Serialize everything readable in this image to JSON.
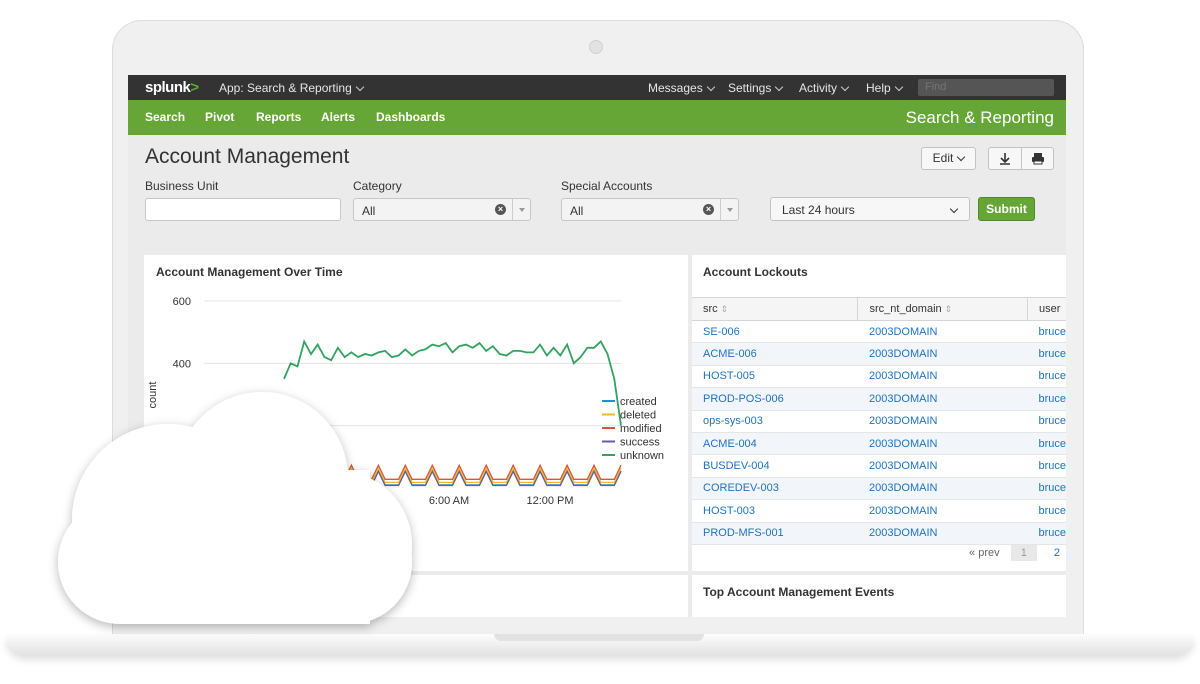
{
  "topbar": {
    "logo_text": "splunk",
    "logo_mark": ">",
    "app_menu": "App: Search & Reporting",
    "menus": [
      "Messages",
      "Settings",
      "Activity",
      "Help"
    ],
    "find_placeholder": "Find"
  },
  "navbar": {
    "items": [
      "Search",
      "Pivot",
      "Reports",
      "Alerts",
      "Dashboards"
    ],
    "app_title": "Search & Reporting"
  },
  "page": {
    "title": "Account Management",
    "edit_label": "Edit",
    "download_icon": "download-icon",
    "print_icon": "print-icon"
  },
  "filters": {
    "business_unit": {
      "label": "Business Unit",
      "value": ""
    },
    "category": {
      "label": "Category",
      "value": "All"
    },
    "special_accounts": {
      "label": "Special Accounts",
      "value": "All"
    },
    "time_range": "Last 24 hours",
    "submit_label": "Submit"
  },
  "panels": {
    "over_time_title": "Account Management Over Time",
    "lockouts_title": "Account Lockouts",
    "top_events_title": "Top Account Management Events"
  },
  "chart_data": {
    "type": "line",
    "ylabel": "count",
    "yticks": [
      "600",
      "400"
    ],
    "ylim": [
      0,
      600
    ],
    "xticks": [
      "6:00 AM",
      "12:00 PM"
    ],
    "grid": true,
    "legend_position": "right",
    "series": [
      {
        "name": "created",
        "color": "#1e93c6"
      },
      {
        "name": "deleted",
        "color": "#f2b827"
      },
      {
        "name": "modified",
        "color": "#d6563c"
      },
      {
        "name": "success",
        "color": "#6a5c9e"
      },
      {
        "name": "unknown",
        "color": "#31a35f",
        "values": [
          350,
          400,
          390,
          470,
          430,
          460,
          420,
          410,
          450,
          420,
          435,
          420,
          430,
          425,
          435,
          440,
          420,
          425,
          445,
          425,
          440,
          445,
          460,
          455,
          465,
          435,
          455,
          460,
          450,
          465,
          440,
          455,
          430,
          425,
          440,
          440,
          435,
          435,
          460,
          425,
          450,
          425,
          460,
          400,
          420,
          450,
          450,
          470,
          430,
          350,
          200
        ]
      }
    ]
  },
  "lockouts": {
    "columns": [
      "src",
      "src_nt_domain",
      "user"
    ],
    "rows": [
      [
        "SE-006",
        "2003DOMAIN",
        "bruce"
      ],
      [
        "ACME-006",
        "2003DOMAIN",
        "bruce"
      ],
      [
        "HOST-005",
        "2003DOMAIN",
        "bruce"
      ],
      [
        "PROD-POS-006",
        "2003DOMAIN",
        "bruce"
      ],
      [
        "ops-sys-003",
        "2003DOMAIN",
        "bruce"
      ],
      [
        "ACME-004",
        "2003DOMAIN",
        "bruce"
      ],
      [
        "BUSDEV-004",
        "2003DOMAIN",
        "bruce"
      ],
      [
        "COREDEV-003",
        "2003DOMAIN",
        "bruce"
      ],
      [
        "HOST-003",
        "2003DOMAIN",
        "bruce"
      ],
      [
        "PROD-MFS-001",
        "2003DOMAIN",
        "bruce"
      ]
    ],
    "pager": {
      "prev": "« prev",
      "pages": [
        "1",
        "2"
      ]
    }
  }
}
